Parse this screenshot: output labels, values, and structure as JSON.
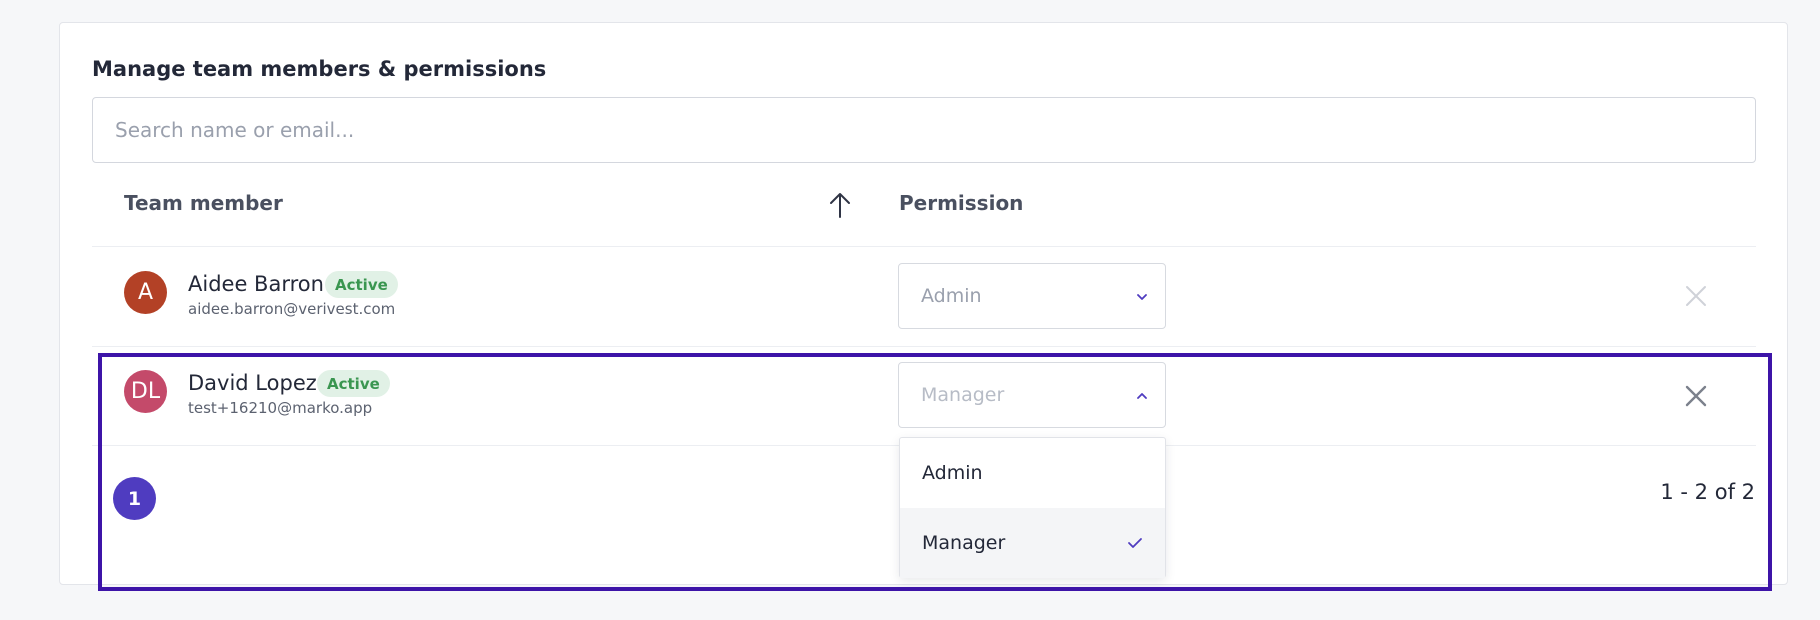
{
  "panel": {
    "title": "Manage team members & permissions",
    "search_placeholder": "Search name or email..."
  },
  "table": {
    "columns": {
      "member": "Team member",
      "permission": "Permission"
    },
    "sort_icon": "arrow-up-icon",
    "rows": [
      {
        "initials": "A",
        "avatar_color": "#b34126",
        "name": "Aidee Barron",
        "status": "Active",
        "email": "aidee.barron@verivest.com",
        "permission": "Admin"
      },
      {
        "initials": "DL",
        "avatar_color": "#c44a6a",
        "name": "David Lopez",
        "status": "Active",
        "email": "test+16210@marko.app",
        "permission": "Manager"
      }
    ]
  },
  "dropdown": {
    "options": [
      "Admin",
      "Manager"
    ],
    "selected": "Manager"
  },
  "pagination": {
    "current_page": "1",
    "range_text": "1 - 2 of 2"
  },
  "colors": {
    "accent": "#4f3cc0",
    "highlight": "#3d14a8",
    "active_badge_bg": "#e1f1e6",
    "active_badge_text": "#3a9650"
  }
}
